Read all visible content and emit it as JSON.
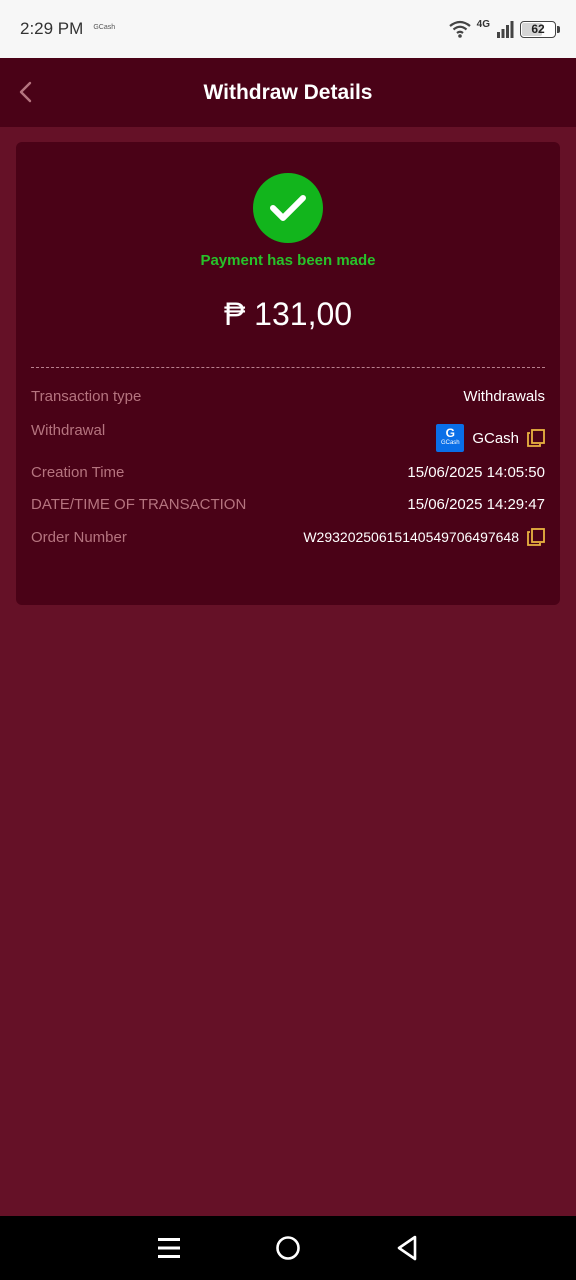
{
  "status_bar": {
    "time": "2:29 PM",
    "app_label": "GCash",
    "network": "4G",
    "battery": "62"
  },
  "header": {
    "title": "Withdraw Details"
  },
  "card": {
    "status_message": "Payment has been made",
    "amount": "₱ 131,00",
    "rows": [
      {
        "label": "Transaction type",
        "value": "Withdrawals"
      },
      {
        "label": "Withdrawal",
        "value": "GCash",
        "logo_text": "GCash"
      },
      {
        "label": "Creation Time",
        "value": "15/06/2025 14:05:50"
      },
      {
        "label": "DATE/TIME OF TRANSACTION",
        "value": "15/06/2025 14:29:47"
      },
      {
        "label": "Order Number",
        "value": "W2932025061514054970649764​8"
      }
    ]
  },
  "colors": {
    "background": "#651127",
    "header_bg": "#4a0217",
    "card_bg": "#4a0217",
    "success": "#12b51c",
    "label": "#b5747f",
    "copy_icon": "#e9b341"
  },
  "icons": {
    "back": "chevron-left-icon",
    "success": "check-circle-icon",
    "copy": "copy-icon",
    "nav_menu": "menu-icon",
    "nav_home": "home-circle-icon",
    "nav_back": "back-triangle-icon"
  }
}
